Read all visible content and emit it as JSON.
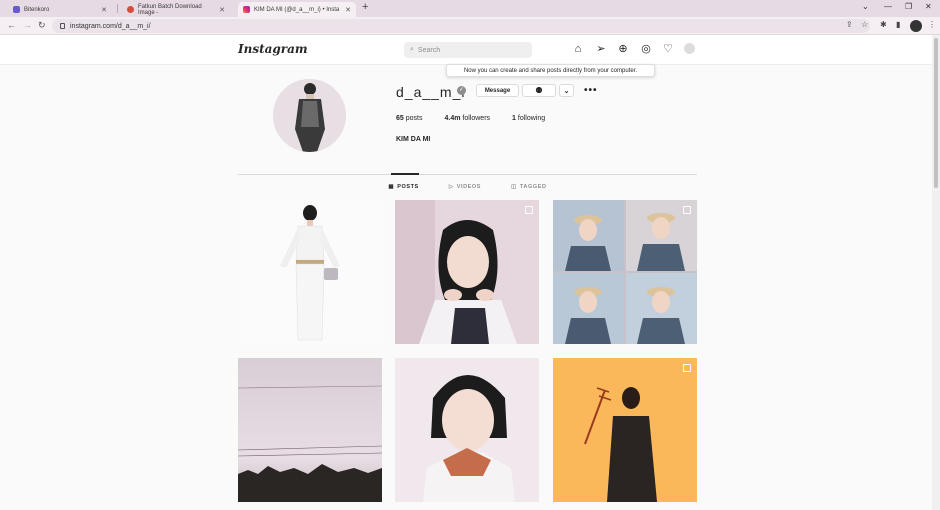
{
  "browser": {
    "tabs": [
      {
        "label": "Bitenkoro",
        "active": false
      },
      {
        "label": "Fatkun Batch Download Image -",
        "active": false
      },
      {
        "label": "KIM DA MI (@d_a__m_i) • Insta",
        "active": true
      }
    ],
    "new_tab": "+",
    "url": "instagram.com/d_a__m_i/"
  },
  "instagram": {
    "logo": "Instagram",
    "search_placeholder": "Search",
    "tooltip": "Now you can create and share posts directly from your computer."
  },
  "profile": {
    "username": "d_a__m_i",
    "message_button": "Message",
    "more": "•••",
    "stats": {
      "posts_count": "65",
      "posts_label": "posts",
      "followers_count": "4.4m",
      "followers_label": "followers",
      "following_count": "1",
      "following_label": "following"
    },
    "full_name": "KIM DA MI"
  },
  "tabs": {
    "posts": "POSTS",
    "videos": "VIDEOS",
    "tagged": "TAGGED"
  },
  "posts": [
    {
      "name": "post-white-outfit",
      "bg": "#fbfbfb",
      "multi": false
    },
    {
      "name": "post-closeup-pink",
      "bg": "#e9d9e1",
      "multi": true
    },
    {
      "name": "post-photo-grid",
      "bg": "#a9b7c9",
      "multi": true
    },
    {
      "name": "post-sky-landscape",
      "bg": "#e3d6df",
      "multi": false
    },
    {
      "name": "post-portrait-red-collar",
      "bg": "#f1e9ee",
      "multi": false
    },
    {
      "name": "post-yellow-background",
      "bg": "#fab85a",
      "multi": true
    }
  ]
}
